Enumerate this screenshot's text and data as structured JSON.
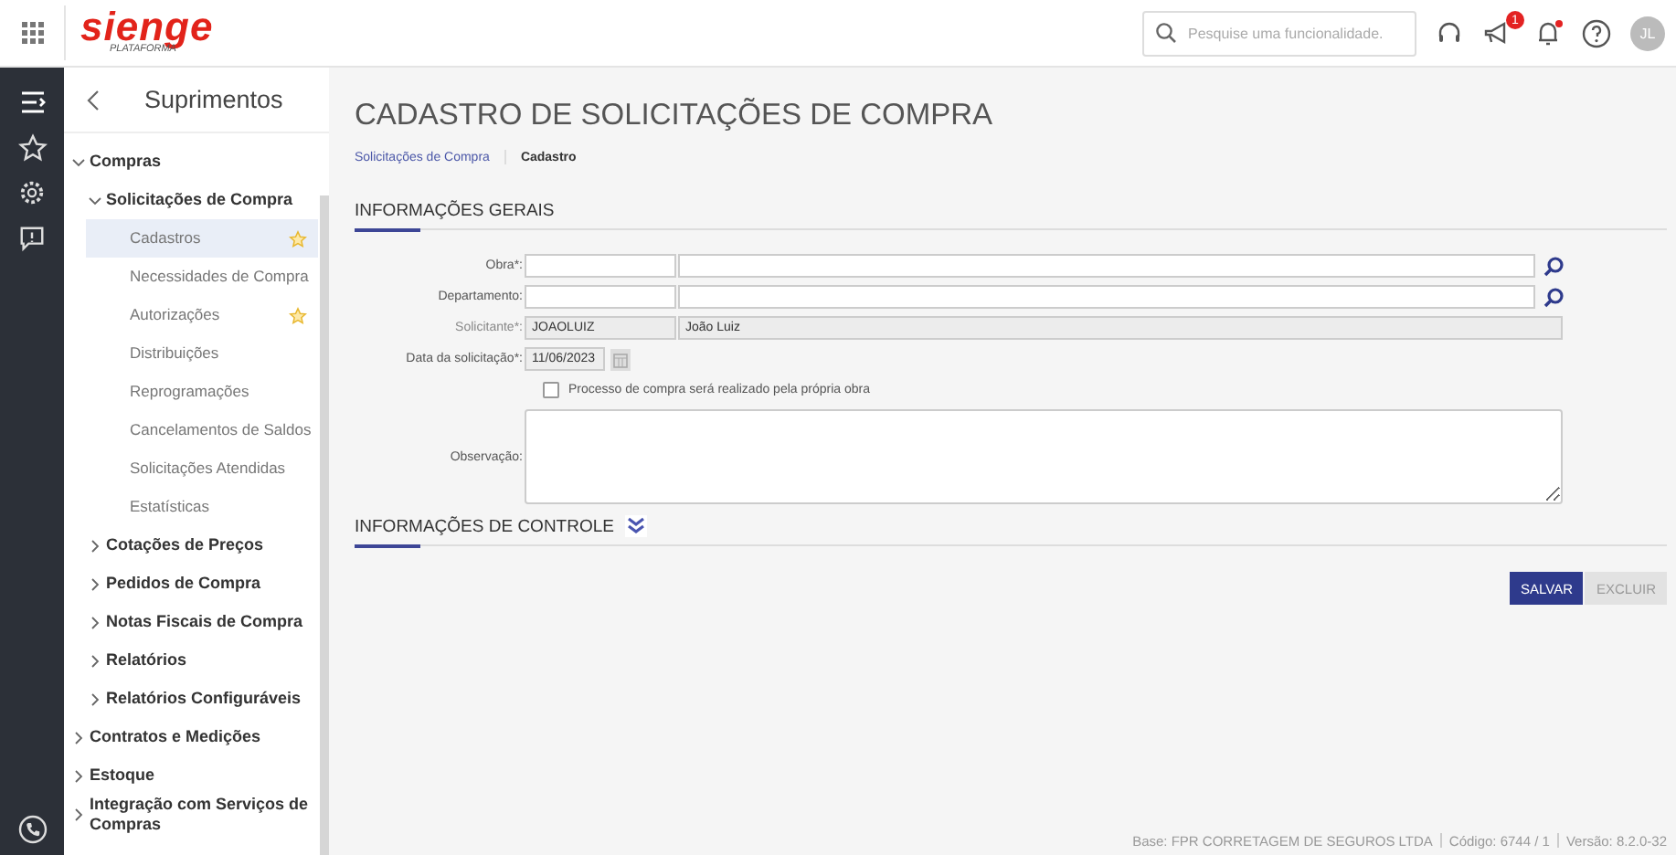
{
  "topbar": {
    "logo": "sienge",
    "logo_subtitle": "PLATAFORMA",
    "search": {
      "placeholder": "Pesquise uma funcionalidade."
    },
    "announcements_badge": "1",
    "notifications_unread": true,
    "avatar": "JL"
  },
  "rail": {
    "items": [
      {
        "kind": "menu",
        "selected": true
      },
      {
        "kind": "star",
        "selected": false
      },
      {
        "kind": "gear",
        "selected": false
      },
      {
        "kind": "feedback",
        "selected": false
      }
    ]
  },
  "sidebar": {
    "title": "Suprimentos",
    "tree": [
      {
        "label": "Compras",
        "expanded": true,
        "children": [
          {
            "label": "Solicitações de Compra",
            "expanded": true,
            "children": [
              {
                "label": "Cadastros",
                "selected": true,
                "starred": true
              },
              {
                "label": "Necessidades de Compra",
                "selected": false,
                "starred": false
              },
              {
                "label": "Autorizações",
                "selected": false,
                "starred": true
              },
              {
                "label": "Distribuições",
                "selected": false,
                "starred": false
              },
              {
                "label": "Reprogramações",
                "selected": false,
                "starred": false
              },
              {
                "label": "Cancelamentos de Saldos",
                "selected": false,
                "starred": false
              },
              {
                "label": "Solicitações Atendidas",
                "selected": false,
                "starred": false
              },
              {
                "label": "Estatísticas",
                "selected": false,
                "starred": false
              }
            ]
          },
          {
            "label": "Cotações de Preços",
            "expanded": false
          },
          {
            "label": "Pedidos de Compra",
            "expanded": false
          },
          {
            "label": "Notas Fiscais de Compra",
            "expanded": false
          },
          {
            "label": "Relatórios",
            "expanded": false
          },
          {
            "label": "Relatórios Configuráveis",
            "expanded": false
          }
        ]
      },
      {
        "label": "Contratos e Medições",
        "expanded": false
      },
      {
        "label": "Estoque",
        "expanded": false
      },
      {
        "label": "Integração com Serviços de Compras",
        "expanded": false
      }
    ]
  },
  "page": {
    "title": "CADASTRO DE SOLICITAÇÕES DE COMPRA",
    "breadcrumb": [
      {
        "label": "Solicitações de Compra",
        "link": true
      },
      {
        "label": "Cadastro",
        "link": false
      }
    ]
  },
  "general_section": {
    "title": "INFORMAÇÕES GERAIS",
    "fields": [
      {
        "kind": "lookup",
        "label": "Obra*:"
      },
      {
        "kind": "lookup",
        "label": "Departamento:"
      },
      {
        "kind": "readonly",
        "label": "Solicitante*:",
        "code": "JOAOLUIZ",
        "value": "João Luiz"
      },
      {
        "kind": "date",
        "label": "Data da solicitação*:",
        "value": "11/06/2023"
      },
      {
        "kind": "checkbox",
        "label": "Processo de compra será realizado pela própria obra",
        "checked": false
      },
      {
        "kind": "textarea",
        "label": "Observação:"
      }
    ]
  },
  "control_section": {
    "title": "INFORMAÇÕES DE CONTROLE",
    "expanded": false
  },
  "buttons": [
    {
      "label": "SALVAR",
      "disabled": false
    },
    {
      "label": "EXCLUIR",
      "disabled": true
    }
  ],
  "status_bar": [
    "Base: FPR CORRETAGEM DE SEGUROS LTDA",
    "Código: 6744 / 1",
    "Versão: 8.2.0-32"
  ]
}
